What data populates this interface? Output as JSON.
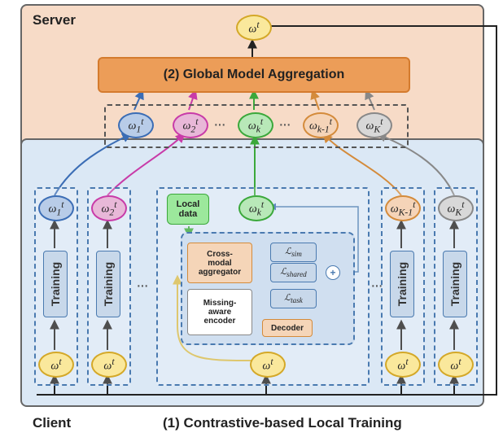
{
  "server_label": "Server",
  "client_label": "Client",
  "bottom_caption": "(1) Contrastive-based Local Training",
  "aggregation_label": "(2) Global Model Aggregation",
  "omega_top": "ωᵗ",
  "server_nodes": {
    "n1": "ω₁ᵗ",
    "n2": "ω₂ᵗ",
    "nk": "ωₖᵗ",
    "nk_1": "ωᵗₖ₋₁",
    "nK": "ωᵗᴊ"
  },
  "client_nodes": {
    "c1": "ω₁ᵗ",
    "c2": "ω₂ᵗ",
    "ck": "ωₖᵗ",
    "ck_1": "ωᵗᴊ₋₁",
    "cK": "ωᵗᴊ"
  },
  "yellow_omega": "ωᵗ",
  "training_label": "Training",
  "local_data_label": "Local\ndata",
  "cross_modal_label": "Cross-\nmodal\naggregator",
  "missing_aware_label": "Missing-\naware\nencoder",
  "decoder_label": "Decoder",
  "losses": {
    "sim": "ℒ_sim",
    "shared": "ℒ_shared",
    "task": "ℒ_task"
  },
  "display": {
    "n1": "ω<sub>1</sub><sup>t</sup>",
    "n2": "ω<sub>2</sub><sup>t</sup>",
    "nk": "ω<sub>k</sub><sup>t</sup>",
    "nk1": "ω<sub>k-1</sub><sup>t</sup>",
    "nK": "ω<sub>K</sub><sup>t</sup>",
    "cK1": "ω<sub>K-1</sub><sup>t</sup>",
    "omega_t": "ω<sup>t</sup>",
    "lsim": "ℒ<sub>sim</sub>",
    "lshared": "ℒ<sub>shared</sub>",
    "ltask": "ℒ<sub>task</sub>"
  }
}
